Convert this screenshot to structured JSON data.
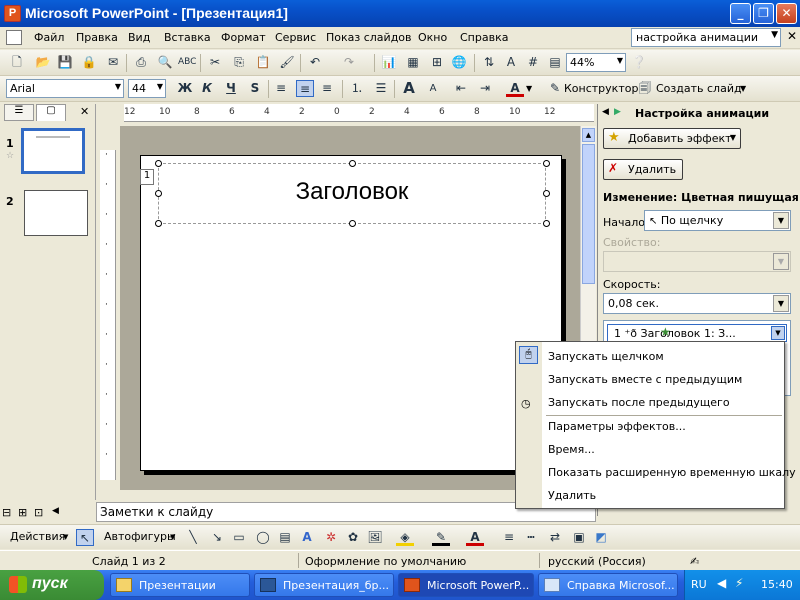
{
  "window": {
    "title": "Microsoft PowerPoint - [Презентация1]",
    "app_letter": "P"
  },
  "menu": {
    "items": [
      "Файл",
      "Правка",
      "Вид",
      "Вставка",
      "Формат",
      "Сервис",
      "Показ слайдов",
      "Окно",
      "Справка"
    ],
    "help_box": "настройка анимации"
  },
  "toolbar": {
    "zoom": "44%"
  },
  "format_bar": {
    "font": "Arial",
    "size": "44",
    "bold": "Ж",
    "italic": "К",
    "underline": "Ч",
    "shadow": "S",
    "designer": "Конструктор",
    "new_slide": "Создать слайд"
  },
  "ruler": {
    "h_ticks": [
      "12",
      "10",
      "8",
      "6",
      "4",
      "2",
      "0",
      "2",
      "4",
      "6",
      "8",
      "10",
      "12"
    ]
  },
  "slides_pane": {
    "slides": [
      "1",
      "2"
    ]
  },
  "slide": {
    "title_text": "Заголовок",
    "anim_tag": "1"
  },
  "notes": {
    "placeholder": "Заметки к слайду"
  },
  "task_pane": {
    "title": "Настройка анимации",
    "add_effect": "Добавить эффект",
    "remove": "Удалить",
    "change_label": "Изменение: Цветная пишущая м",
    "start_label": "Начало:",
    "start_value": "По щелчку",
    "property_label": "Свойство:",
    "speed_label": "Скорость:",
    "speed_value": "0,08 сек.",
    "list_item": "1 ⁺ð      Заголовок 1: З..."
  },
  "context_menu": {
    "items": [
      "Запускать щелчком",
      "Запускать вместе с предыдущим",
      "Запускать после предыдущего",
      "Параметры эффектов...",
      "Время...",
      "Показать расширенную временную шкалу",
      "Удалить"
    ]
  },
  "drawing_bar": {
    "actions": "Действия",
    "autoshapes": "Автофигуры"
  },
  "status": {
    "slide": "Слайд 1 из 2",
    "design": "Оформление по умолчанию",
    "language": "русский (Россия)"
  },
  "taskbar": {
    "start": "пуск",
    "tasks": [
      "Презентации",
      "Презентация_бр...",
      "Microsoft PowerP...",
      "Справка Microsof..."
    ],
    "lang": "RU",
    "clock": "15:40"
  },
  "colors": {
    "titlebar": "#0a5fd8",
    "taskbar": "#245edb",
    "start": "#3a8b34",
    "workspace": "#aca899"
  }
}
